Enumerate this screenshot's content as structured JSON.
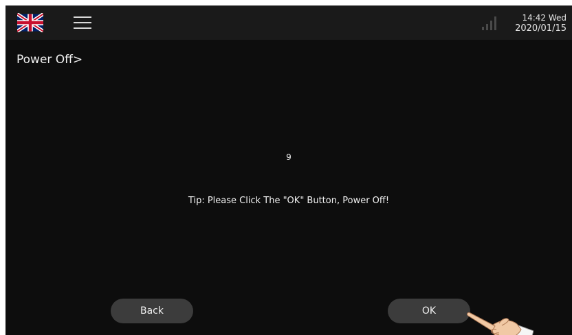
{
  "header": {
    "flag_icon": "uk-flag-icon",
    "menu_icon": "hamburger-menu-icon",
    "signal_icon": "signal-strength-icon",
    "time": "14:42 Wed",
    "date": "2020/01/15"
  },
  "page": {
    "title": "Power Off>",
    "countdown": "9",
    "tip": "Tip: Please Click The \"OK\" Button, Power Off!"
  },
  "buttons": {
    "back_label": "Back",
    "ok_label": "OK"
  },
  "colors": {
    "background": "#0d0d0d",
    "topbar": "#1a1a1a",
    "button": "#3c3c3c",
    "text": "#f0f0f0"
  },
  "decoration": {
    "pointer_icon": "pointing-hand-icon"
  }
}
